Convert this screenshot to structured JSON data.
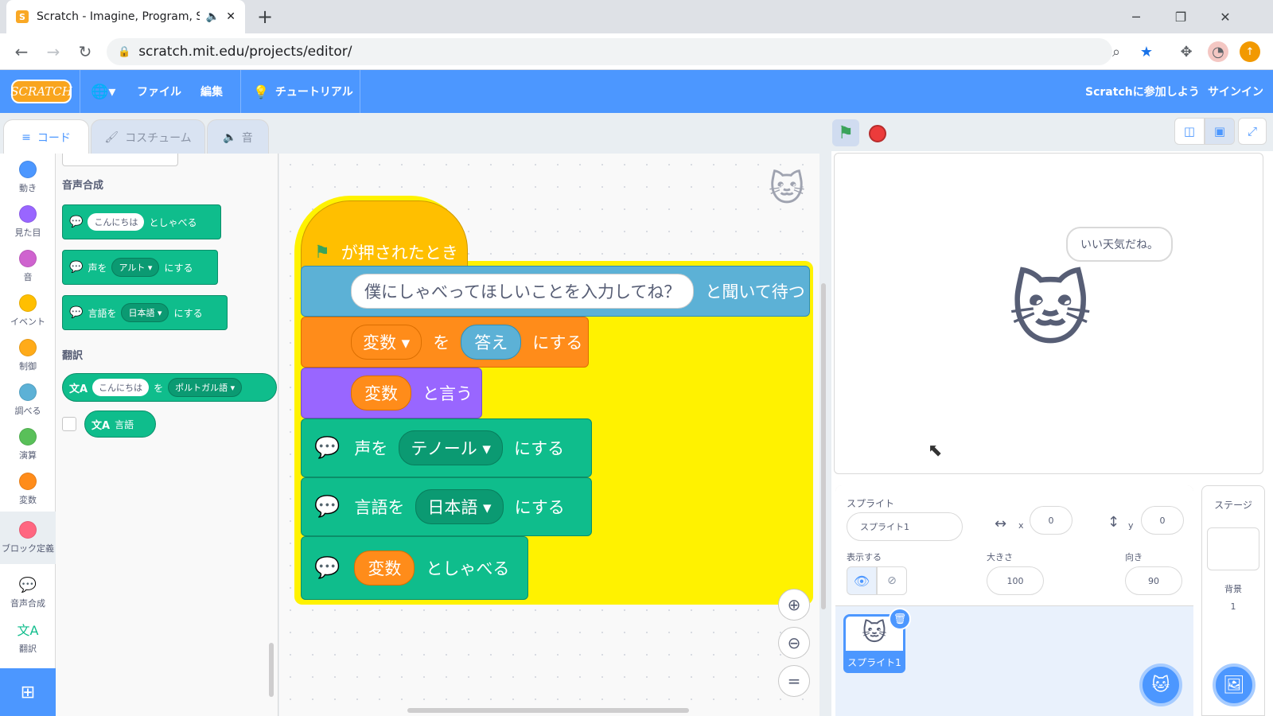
{
  "browser": {
    "tab_title": "Scratch - Imagine, Program, S",
    "url": "scratch.mit.edu/projects/editor/"
  },
  "menu": {
    "logo": "SCRATCH",
    "file": "ファイル",
    "edit": "編集",
    "tutorials": "チュートリアル",
    "join": "Scratchに参加しよう",
    "signin": "サインイン"
  },
  "tabs": {
    "code": "コード",
    "costumes": "コスチューム",
    "sounds": "音"
  },
  "categories": [
    {
      "label": "動き",
      "color": "#4c97ff"
    },
    {
      "label": "見た目",
      "color": "#9966ff"
    },
    {
      "label": "音",
      "color": "#cf63cf"
    },
    {
      "label": "イベント",
      "color": "#ffbf00"
    },
    {
      "label": "制御",
      "color": "#ffab19"
    },
    {
      "label": "調べる",
      "color": "#5cb1d6"
    },
    {
      "label": "演算",
      "color": "#59c059"
    },
    {
      "label": "変数",
      "color": "#ff8c1a"
    },
    {
      "label": "ブロック定義",
      "color": "#ff6680"
    },
    {
      "label": "音声合成",
      "color": "#0fbd8c"
    },
    {
      "label": "翻訳",
      "color": "#0fbd8c"
    }
  ],
  "palette": {
    "tts_heading": "音声合成",
    "speak_input": "こんにちは",
    "speak_suffix": "としゃべる",
    "voice_prefix": "声を",
    "voice_value": "アルト",
    "voice_suffix": "にする",
    "lang_prefix": "言語を",
    "lang_value": "日本語",
    "lang_suffix": "にする",
    "translate_heading": "翻訳",
    "translate_input": "こんにちは",
    "translate_mid": "を",
    "translate_lang": "ポルトガル語",
    "language_reporter": "言語"
  },
  "script": {
    "hat": "が押されたとき",
    "ask_input": "僕にしゃべってほしいことを入力してね？",
    "ask_suffix": "と聞いて待つ",
    "set_var": "変数",
    "set_mid": "を",
    "set_value": "答え",
    "set_suffix": "にする",
    "say_var": "変数",
    "say_suffix": "と言う",
    "voice_prefix": "声を",
    "voice_value": "テノール",
    "voice_suffix": "にする",
    "lang_prefix": "言語を",
    "lang_value": "日本語",
    "lang_suffix": "にする",
    "speak_var": "変数",
    "speak_suffix": "としゃべる"
  },
  "stage": {
    "bubble": "いい天気だね。"
  },
  "sprite_info": {
    "heading": "スプライト",
    "name": "スプライト1",
    "x_label": "x",
    "x": "0",
    "y_label": "y",
    "y": "0",
    "show_label": "表示する",
    "size_label": "大きさ",
    "size": "100",
    "direction_label": "向き",
    "direction": "90",
    "thumb_label": "スプライト1"
  },
  "stage_pane": {
    "heading": "ステージ",
    "backdrops_label": "背景",
    "backdrops_count": "1"
  }
}
